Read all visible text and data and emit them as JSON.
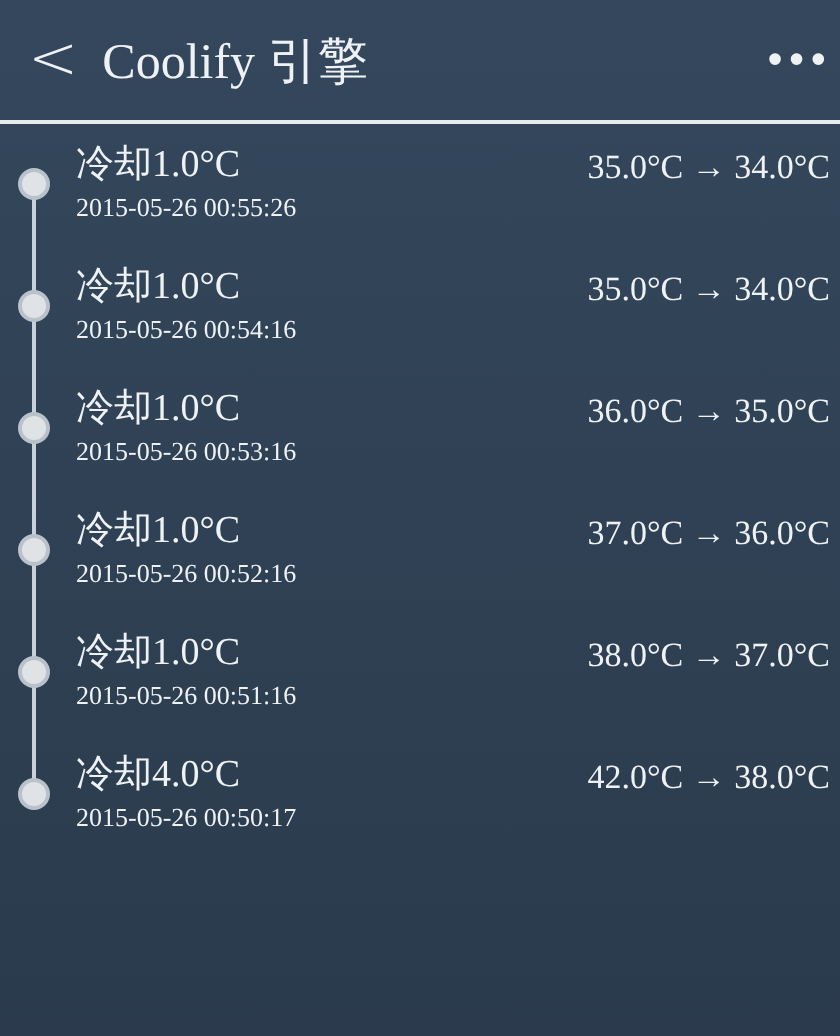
{
  "header": {
    "back": "<",
    "title": "Coolify 引擎",
    "menu": "•••"
  },
  "records": [
    {
      "title": "冷却1.0°C",
      "time": "2015-05-26 00:55:26",
      "change": "35.0°C → 34.0°C"
    },
    {
      "title": "冷却1.0°C",
      "time": "2015-05-26 00:54:16",
      "change": "35.0°C → 34.0°C"
    },
    {
      "title": "冷却1.0°C",
      "time": "2015-05-26 00:53:16",
      "change": "36.0°C → 35.0°C"
    },
    {
      "title": "冷却1.0°C",
      "time": "2015-05-26 00:52:16",
      "change": "37.0°C → 36.0°C"
    },
    {
      "title": "冷却1.0°C",
      "time": "2015-05-26 00:51:16",
      "change": "38.0°C → 37.0°C"
    },
    {
      "title": "冷却4.0°C",
      "time": "2015-05-26 00:50:17",
      "change": "42.0°C → 38.0°C"
    }
  ]
}
